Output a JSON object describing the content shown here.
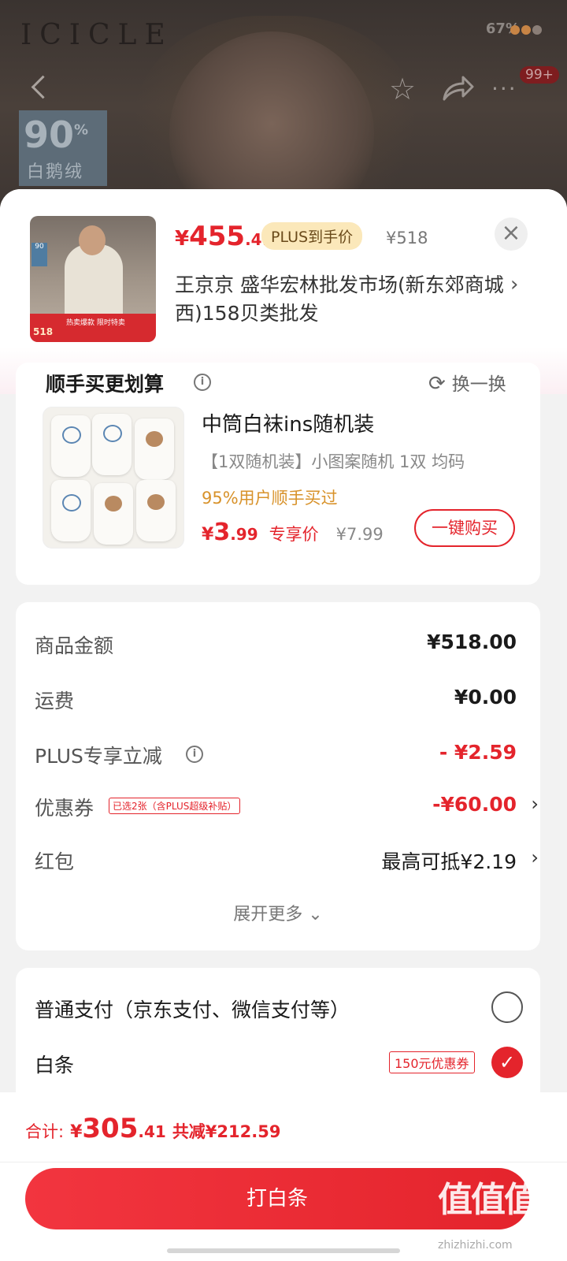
{
  "background": {
    "brand": "ICICLE",
    "status": "67%",
    "message_badge": "99+",
    "down_badge": {
      "number": "90",
      "unit": "%",
      "label": "白鹅绒"
    }
  },
  "product": {
    "price_currency": "¥",
    "price_int": "455",
    "price_dec": ".41",
    "plus_tag": "PLUS到手价",
    "original_price": "¥518",
    "store": "王京京  盛华宏林批发市场(新东郊商城西)158贝类批发",
    "thumb_price": "518",
    "thumb_tag": "热卖爆款 限时特卖"
  },
  "addon": {
    "title": "顺手买更划算",
    "refresh_label": "换一换",
    "item_name": "中筒白袜ins随机装",
    "item_spec": "【1双随机装】小图案随机 1双   均码",
    "item_social": "95%用户顺手买过",
    "price_currency": "¥",
    "price_int": "3",
    "price_dec": ".99",
    "price_label": "专享价",
    "original_price": "¥7.99",
    "buy_label": "一键购买"
  },
  "fees": {
    "rows": [
      {
        "label": "商品金额",
        "value": "¥518.00"
      },
      {
        "label": "运费",
        "value": "¥0.00"
      },
      {
        "label": "PLUS专享立减",
        "value": "- ¥2.59"
      },
      {
        "label": "优惠券",
        "value": "-¥60.00",
        "tag": "已选2张（含PLUS超级补贴）"
      },
      {
        "label": "红包",
        "value": "最高可抵¥2.19"
      }
    ],
    "expand_label": "展开更多 ⌄"
  },
  "payment": {
    "option1": "普通支付（京东支付、微信支付等）",
    "option2": "白条",
    "coupon": "150元优惠券"
  },
  "footer": {
    "total_label": "合计:",
    "total_currency": "¥",
    "total_int": "305",
    "total_dec": ".41",
    "saved": "共减¥212.59",
    "pay_button": "打白条",
    "watermark": "值值值",
    "watermark_url": "zhizhizhi.com"
  },
  "colors": {
    "accent": "#e4242c",
    "plus": "#fbe8ba",
    "social": "#d8922a"
  },
  "icons": [
    "back-icon",
    "star-icon",
    "share-icon",
    "more-icon",
    "close-icon",
    "chevron-right-icon",
    "info-icon",
    "refresh-icon",
    "check-icon"
  ]
}
